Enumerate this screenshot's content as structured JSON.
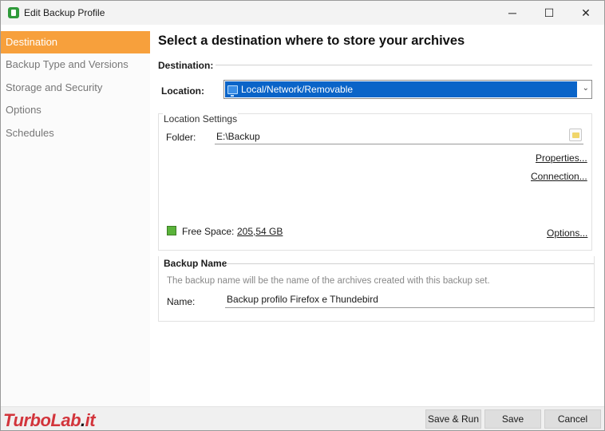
{
  "window": {
    "title": "Edit Backup Profile",
    "controls": {
      "minimize": "─",
      "maximize": "☐",
      "close": "✕"
    }
  },
  "sidebar": {
    "items": [
      {
        "label": "Destination",
        "active": true
      },
      {
        "label": "Backup Type and Versions",
        "active": false
      },
      {
        "label": "Storage and Security",
        "active": false
      },
      {
        "label": "Options",
        "active": false
      },
      {
        "label": "Schedules",
        "active": false
      }
    ]
  },
  "main": {
    "heading": "Select a destination where to store your archives",
    "destination_label": "Destination:",
    "location": {
      "label": "Location:",
      "selected": "Local/Network/Removable",
      "icon": "monitor-icon"
    },
    "location_settings": {
      "title": "Location Settings",
      "folder_label": "Folder:",
      "folder_value": "E:\\Backup",
      "properties_link": "Properties...",
      "connection_link": "Connection...",
      "free_space_label": "Free Space:",
      "free_space_value": "205,54 GB",
      "options_link": "Options..."
    },
    "backup_name": {
      "title": "Backup Name",
      "hint": "The backup name will be the name of the archives created with this backup set.",
      "name_label": "Name:",
      "name_value": "Backup profilo Firefox e Thundebird"
    }
  },
  "footer": {
    "watermark_left": "TurboLab",
    "watermark_dot": ".",
    "watermark_right": "it",
    "save_run": "Save & Run",
    "save": "Save",
    "cancel": "Cancel"
  },
  "colors": {
    "accent_active": "#f7a03c",
    "select_highlight": "#0a64c8",
    "free_space": "#5ab33a",
    "watermark": "#d2343b"
  }
}
